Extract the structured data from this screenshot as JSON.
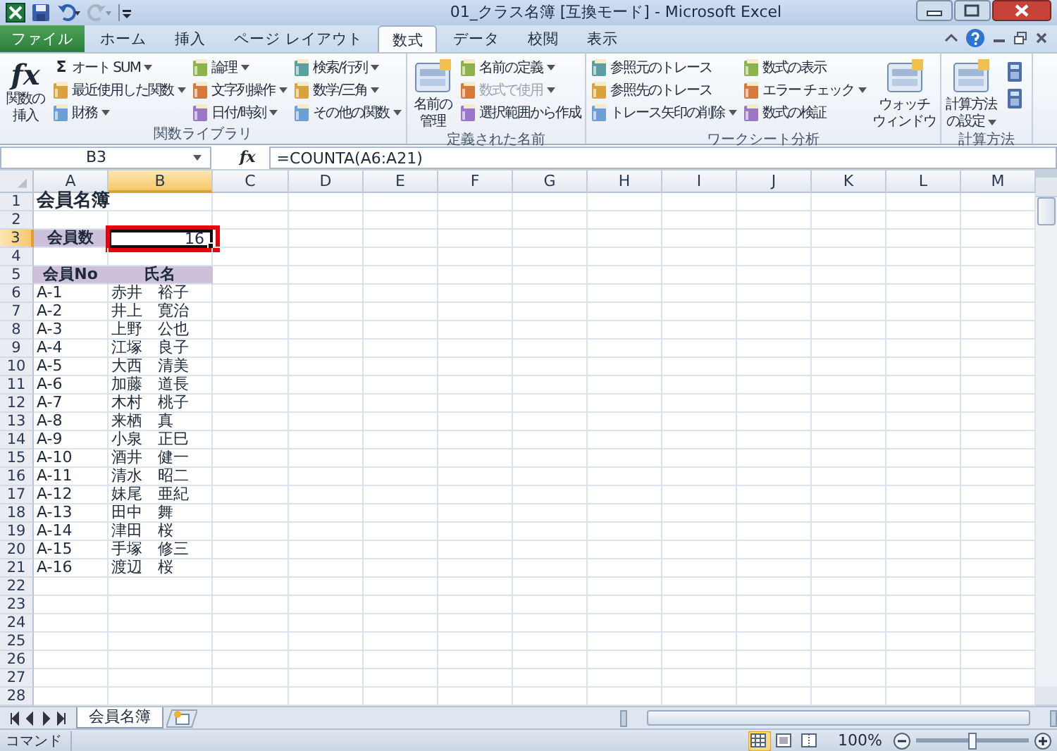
{
  "window": {
    "title": "01_クラス名簿 [互換モード] - Microsoft Excel"
  },
  "tabs": [
    {
      "label": "ファイル",
      "kind": "file",
      "selected": false
    },
    {
      "label": "ホーム",
      "kind": "tab",
      "selected": false
    },
    {
      "label": "挿入",
      "kind": "tab",
      "selected": false
    },
    {
      "label": "ページ レイアウト",
      "kind": "tab",
      "selected": false
    },
    {
      "label": "数式",
      "kind": "tab",
      "selected": true
    },
    {
      "label": "データ",
      "kind": "tab",
      "selected": false
    },
    {
      "label": "校閲",
      "kind": "tab",
      "selected": false
    },
    {
      "label": "表示",
      "kind": "tab",
      "selected": false
    }
  ],
  "ribbon": {
    "groups": [
      {
        "label": "関数ライブラリ",
        "columns": [
          [
            {
              "kind": "large",
              "label_lines": [
                "関数の",
                "挿入"
              ],
              "icon_text": "fx",
              "dropdown": false,
              "disabled": false
            }
          ],
          [
            {
              "kind": "small",
              "label": "オート SUM",
              "icon_text": "Σ",
              "dropdown": true,
              "disabled": false
            },
            {
              "kind": "small",
              "label": "最近使用した関数",
              "dropdown": true,
              "disabled": false
            },
            {
              "kind": "small",
              "label": "財務",
              "dropdown": true,
              "disabled": false
            }
          ],
          [
            {
              "kind": "small",
              "label": "論理",
              "dropdown": true,
              "disabled": false
            },
            {
              "kind": "small",
              "label": "文字列操作",
              "dropdown": true,
              "disabled": false
            },
            {
              "kind": "small",
              "label": "日付/時刻",
              "dropdown": true,
              "disabled": false
            }
          ],
          [
            {
              "kind": "small",
              "label": "検索/行列",
              "dropdown": true,
              "disabled": false
            },
            {
              "kind": "small",
              "label": "数学/三角",
              "dropdown": true,
              "disabled": false
            },
            {
              "kind": "small",
              "label": "その他の関数",
              "dropdown": true,
              "disabled": false
            }
          ]
        ]
      },
      {
        "label": "定義された名前",
        "columns": [
          [
            {
              "kind": "large",
              "label_lines": [
                "名前の",
                "管理"
              ],
              "dropdown": false,
              "disabled": false
            }
          ],
          [
            {
              "kind": "small",
              "label": "名前の定義",
              "dropdown": true,
              "disabled": false
            },
            {
              "kind": "small",
              "label": "数式で使用",
              "dropdown": true,
              "disabled": true
            },
            {
              "kind": "small",
              "label": "選択範囲から作成",
              "dropdown": false,
              "disabled": false
            }
          ]
        ]
      },
      {
        "label": "ワークシート分析",
        "columns": [
          [
            {
              "kind": "small",
              "label": "参照元のトレース",
              "dropdown": false,
              "disabled": false
            },
            {
              "kind": "small",
              "label": "参照先のトレース",
              "dropdown": false,
              "disabled": false
            },
            {
              "kind": "small",
              "label": "トレース矢印の削除",
              "dropdown": true,
              "disabled": false
            }
          ],
          [
            {
              "kind": "small",
              "label": "数式の表示",
              "dropdown": false,
              "disabled": false
            },
            {
              "kind": "small",
              "label": "エラー チェック",
              "dropdown": true,
              "disabled": false
            },
            {
              "kind": "small",
              "label": "数式の検証",
              "dropdown": false,
              "disabled": false
            }
          ],
          [
            {
              "kind": "large",
              "label_lines": [
                "ウォッチ",
                "ウィンドウ"
              ],
              "dropdown": false,
              "disabled": false
            }
          ]
        ]
      },
      {
        "label": "計算方法",
        "columns": [
          [
            {
              "kind": "large",
              "label_lines": [
                "計算方法",
                "の設定"
              ],
              "dropdown": true,
              "disabled": false
            }
          ],
          [
            {
              "kind": "icon"
            },
            {
              "kind": "icon"
            }
          ]
        ]
      }
    ]
  },
  "formula_bar": {
    "name_box": "B3",
    "fx_label": "fx",
    "formula": "=COUNTA(A6:A21)"
  },
  "columns": [
    {
      "label": "A",
      "selected": false
    },
    {
      "label": "B",
      "selected": true
    },
    {
      "label": "C",
      "selected": false
    },
    {
      "label": "D",
      "selected": false
    },
    {
      "label": "E",
      "selected": false
    },
    {
      "label": "F",
      "selected": false
    },
    {
      "label": "G",
      "selected": false
    },
    {
      "label": "H",
      "selected": false
    },
    {
      "label": "I",
      "selected": false
    },
    {
      "label": "J",
      "selected": false
    },
    {
      "label": "K",
      "selected": false
    },
    {
      "label": "L",
      "selected": false
    },
    {
      "label": "M",
      "selected": false
    }
  ],
  "rows": [
    {
      "number": "1",
      "selected": false,
      "kind": "title",
      "a": "会員名簿"
    },
    {
      "number": "2",
      "selected": false,
      "kind": "plain"
    },
    {
      "number": "3",
      "selected": true,
      "kind": "count",
      "a": "会員数",
      "b": "16",
      "b_active": true,
      "b_highlighted": true
    },
    {
      "number": "4",
      "selected": false,
      "kind": "plain"
    },
    {
      "number": "5",
      "selected": false,
      "kind": "header",
      "a": "会員No",
      "b": "氏名"
    },
    {
      "number": "6",
      "selected": false,
      "kind": "plain",
      "a": "A-1",
      "b": "赤井　裕子"
    },
    {
      "number": "7",
      "selected": false,
      "kind": "plain",
      "a": "A-2",
      "b": "井上　寛治"
    },
    {
      "number": "8",
      "selected": false,
      "kind": "plain",
      "a": "A-3",
      "b": "上野　公也"
    },
    {
      "number": "9",
      "selected": false,
      "kind": "plain",
      "a": "A-4",
      "b": "江塚　良子"
    },
    {
      "number": "10",
      "selected": false,
      "kind": "plain",
      "a": "A-5",
      "b": "大西　清美"
    },
    {
      "number": "11",
      "selected": false,
      "kind": "plain",
      "a": "A-6",
      "b": "加藤　道長"
    },
    {
      "number": "12",
      "selected": false,
      "kind": "plain",
      "a": "A-7",
      "b": "木村　桃子"
    },
    {
      "number": "13",
      "selected": false,
      "kind": "plain",
      "a": "A-8",
      "b": "来栖　真"
    },
    {
      "number": "14",
      "selected": false,
      "kind": "plain",
      "a": "A-9",
      "b": "小泉　正巳"
    },
    {
      "number": "15",
      "selected": false,
      "kind": "plain",
      "a": "A-10",
      "b": "酒井　健一"
    },
    {
      "number": "16",
      "selected": false,
      "kind": "plain",
      "a": "A-11",
      "b": "清水　昭二"
    },
    {
      "number": "17",
      "selected": false,
      "kind": "plain",
      "a": "A-12",
      "b": "妹尾　亜紀"
    },
    {
      "number": "18",
      "selected": false,
      "kind": "plain",
      "a": "A-13",
      "b": "田中　舞"
    },
    {
      "number": "19",
      "selected": false,
      "kind": "plain",
      "a": "A-14",
      "b": "津田　桜"
    },
    {
      "number": "20",
      "selected": false,
      "kind": "plain",
      "a": "A-15",
      "b": "手塚　修三"
    },
    {
      "number": "21",
      "selected": false,
      "kind": "plain",
      "a": "A-16",
      "b": "渡辺　桜"
    },
    {
      "number": "22",
      "selected": false,
      "kind": "plain"
    },
    {
      "number": "23",
      "selected": false,
      "kind": "plain"
    },
    {
      "number": "24",
      "selected": false,
      "kind": "plain"
    },
    {
      "number": "25",
      "selected": false,
      "kind": "plain"
    },
    {
      "number": "26",
      "selected": false,
      "kind": "plain"
    },
    {
      "number": "27",
      "selected": false,
      "kind": "plain"
    },
    {
      "number": "28",
      "selected": false,
      "kind": "plain"
    }
  ],
  "sheet_tabs": [
    {
      "label": "会員名簿",
      "selected": true
    }
  ],
  "status_bar": {
    "mode": "コマンド",
    "views": [
      {
        "kind": "normal",
        "selected": true
      },
      {
        "kind": "page_layout",
        "selected": false
      },
      {
        "kind": "page_break",
        "selected": false
      }
    ],
    "zoom": "100%",
    "zoom_slider": {
      "level": 0.5
    }
  }
}
